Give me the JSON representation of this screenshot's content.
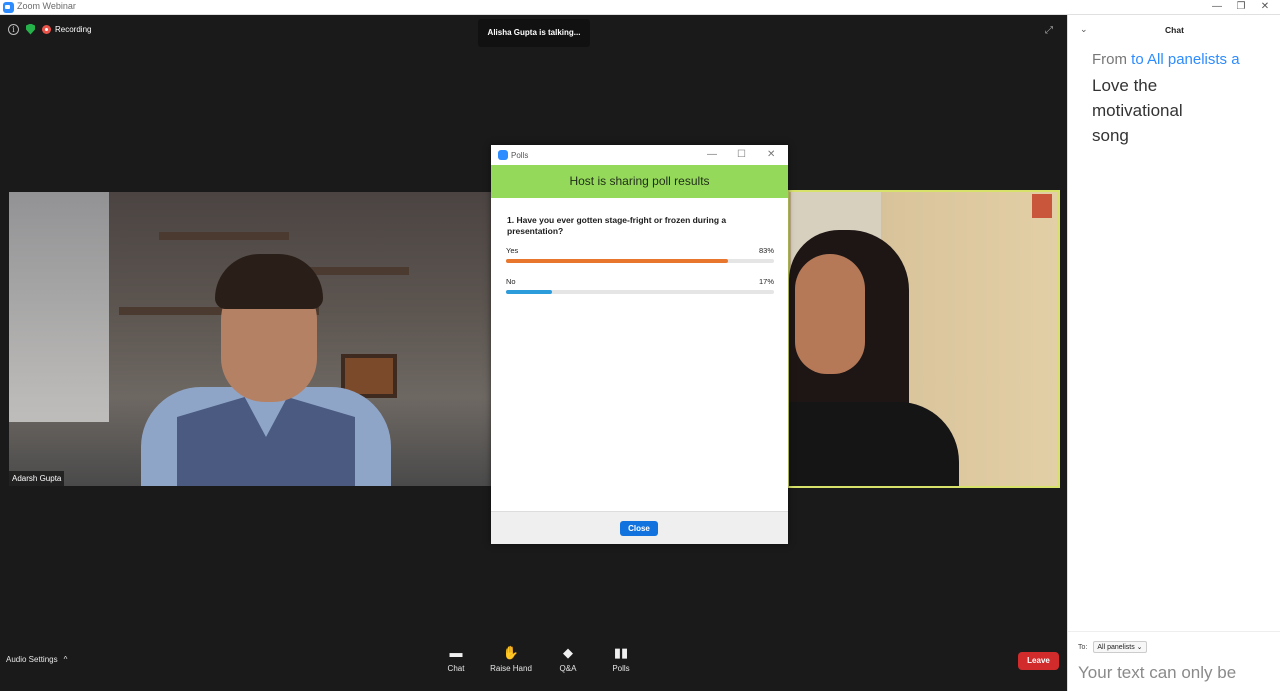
{
  "window": {
    "title": "Zoom Webinar",
    "controls": {
      "minimize": "—",
      "restore": "❐",
      "close": "✕"
    }
  },
  "meeting": {
    "recording_label": "Recording",
    "talking_indicator": "Alisha Gupta is talking...",
    "participants": [
      {
        "name": "Adarsh Gupta",
        "active_speaker": false
      },
      {
        "name": "",
        "active_speaker": true
      }
    ],
    "accent_speaker_border": "#d6e26a"
  },
  "toolbar": {
    "audio_settings": "Audio Settings",
    "audio_chevron": "^",
    "items": [
      {
        "label": "Chat",
        "icon": "chat-bubble-icon"
      },
      {
        "label": "Raise Hand",
        "icon": "hand-icon"
      },
      {
        "label": "Q&A",
        "icon": "qa-icon"
      },
      {
        "label": "Polls",
        "icon": "polls-icon"
      }
    ],
    "leave_label": "Leave",
    "leave_color": "#d12b2b"
  },
  "polls": {
    "window_title": "Polls",
    "header": "Host is sharing poll results",
    "header_color": "#95d95a",
    "question": "1. Have you ever gotten stage-fright or frozen during a presentation?",
    "options": [
      {
        "label": "Yes",
        "percent_text": "83%",
        "percent": 83,
        "color": "#e8762c"
      },
      {
        "label": "No",
        "percent_text": "17%",
        "percent": 17,
        "color": "#2d9cdb"
      }
    ],
    "close_label": "Close"
  },
  "chat": {
    "title": "Chat",
    "message": {
      "from": "From",
      "to": "to All panelists a",
      "text": "Love the motivational song"
    },
    "to_label": "To:",
    "to_value": "All panelists ⌄",
    "input_placeholder": "Your text can only be"
  }
}
